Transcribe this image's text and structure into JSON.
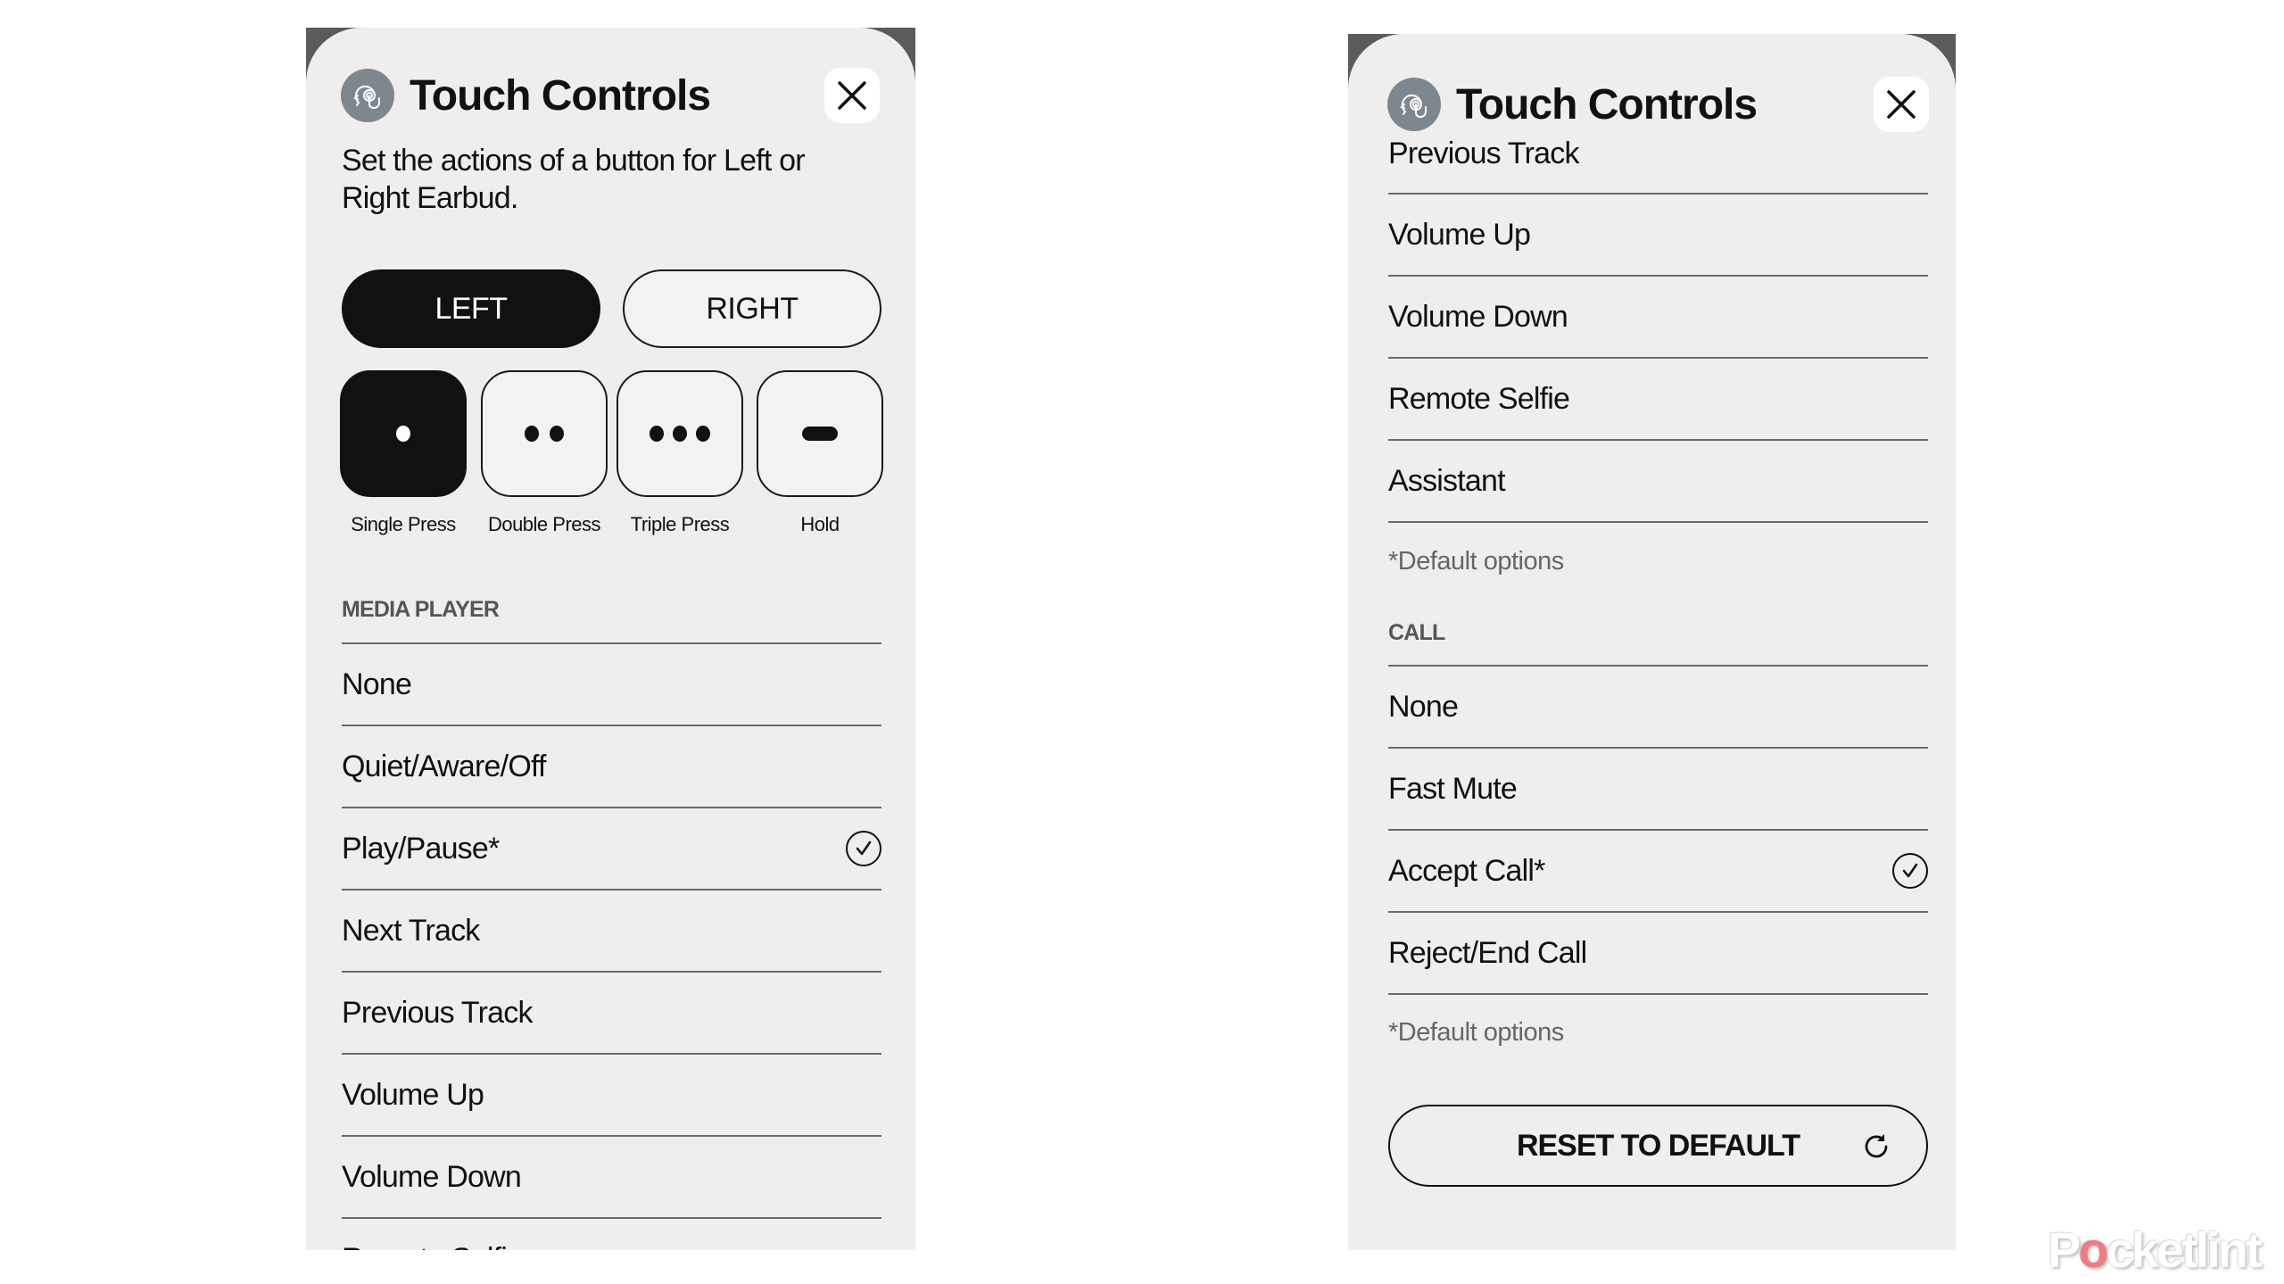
{
  "left_panel": {
    "title": "Touch Controls",
    "subtitle": "Set the actions of a button for Left or Right Earbud.",
    "earbud_toggle": {
      "options": [
        "LEFT",
        "RIGHT"
      ],
      "selected": "LEFT"
    },
    "press_types": [
      {
        "label": "Single Press",
        "icon": "single-dot-icon",
        "selected": true
      },
      {
        "label": "Double Press",
        "icon": "double-dot-icon",
        "selected": false
      },
      {
        "label": "Triple Press",
        "icon": "triple-dot-icon",
        "selected": false
      },
      {
        "label": "Hold",
        "icon": "hold-bar-icon",
        "selected": false
      }
    ],
    "section_label": "MEDIA PLAYER",
    "items": [
      {
        "label": "None",
        "checked": false
      },
      {
        "label": "Quiet/Aware/Off",
        "checked": false
      },
      {
        "label": "Play/Pause*",
        "checked": true
      },
      {
        "label": "Next Track",
        "checked": false
      },
      {
        "label": "Previous Track",
        "checked": false
      },
      {
        "label": "Volume Up",
        "checked": false
      },
      {
        "label": "Volume Down",
        "checked": false
      },
      {
        "label": "Remote Selfie",
        "checked": false
      }
    ]
  },
  "right_panel": {
    "title": "Touch Controls",
    "media_items": [
      {
        "label": "Previous Track",
        "checked": false
      },
      {
        "label": "Volume Up",
        "checked": false
      },
      {
        "label": "Volume Down",
        "checked": false
      },
      {
        "label": "Remote Selfie",
        "checked": false
      },
      {
        "label": "Assistant",
        "checked": false
      }
    ],
    "media_note": "*Default options",
    "call_section_label": "CALL",
    "call_items": [
      {
        "label": "None",
        "checked": false
      },
      {
        "label": "Fast Mute",
        "checked": false
      },
      {
        "label": "Accept Call*",
        "checked": true
      },
      {
        "label": "Reject/End Call",
        "checked": false
      }
    ],
    "call_note": "*Default options",
    "reset_button": "RESET TO DEFAULT"
  },
  "watermark": {
    "prefix": "P",
    "o": "o",
    "suffix": "cketlint"
  },
  "colors": {
    "panel_bg": "#efeeec",
    "active_fill": "#111111",
    "icon_circle": "#7d8790",
    "watermark_accent": "#ef7b86"
  }
}
